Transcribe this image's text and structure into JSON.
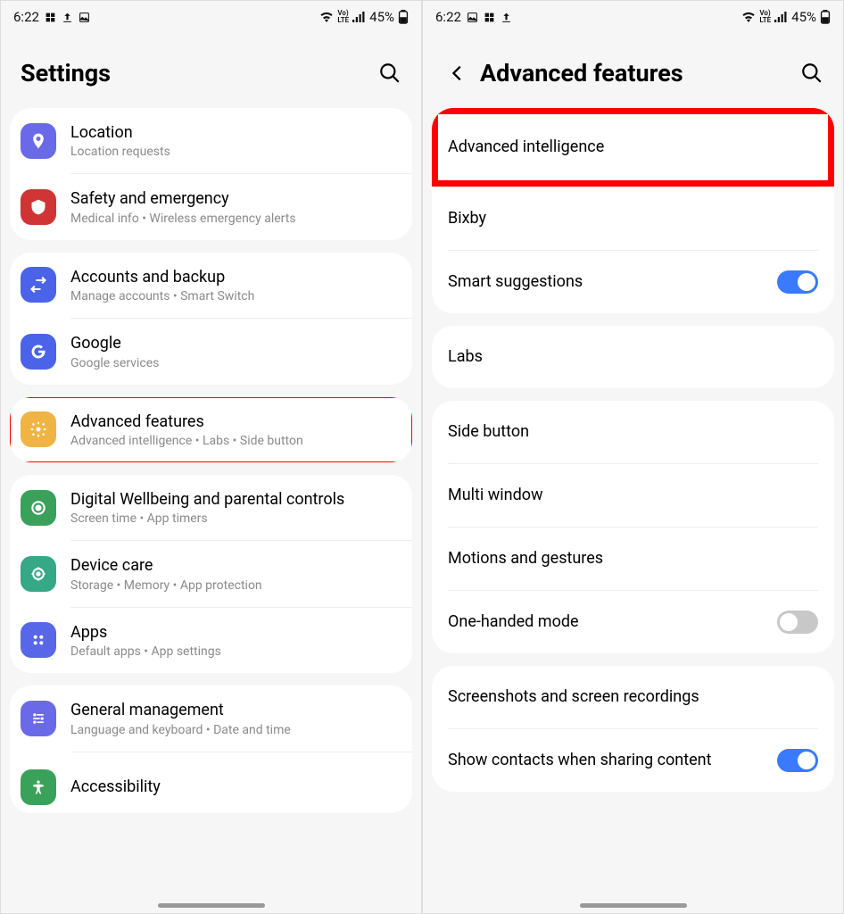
{
  "status": {
    "time": "6:22",
    "battery": "45%"
  },
  "screenLeft": {
    "title": "Settings",
    "rows": {
      "location": {
        "label": "Location",
        "sub": "Location requests"
      },
      "safety": {
        "label": "Safety and emergency",
        "sub": "Medical info  •  Wireless emergency alerts"
      },
      "accounts": {
        "label": "Accounts and backup",
        "sub": "Manage accounts  •  Smart Switch"
      },
      "google": {
        "label": "Google",
        "sub": "Google services"
      },
      "advanced": {
        "label": "Advanced features",
        "sub": "Advanced intelligence  •  Labs  •  Side button"
      },
      "wellbeing": {
        "label": "Digital Wellbeing and parental controls",
        "sub": "Screen time  •  App timers"
      },
      "devicecare": {
        "label": "Device care",
        "sub": "Storage  •  Memory  •  App protection"
      },
      "apps": {
        "label": "Apps",
        "sub": "Default apps  •  App settings"
      },
      "general": {
        "label": "General management",
        "sub": "Language and keyboard  •  Date and time"
      },
      "accessibility": {
        "label": "Accessibility"
      }
    }
  },
  "screenRight": {
    "title": "Advanced features",
    "rows": {
      "ai": "Advanced intelligence",
      "bixby": "Bixby",
      "smart": "Smart suggestions",
      "labs": "Labs",
      "side": "Side button",
      "multi": "Multi window",
      "motions": "Motions and gestures",
      "onehand": "One-handed mode",
      "screenshots": "Screenshots and screen recordings",
      "sharecontacts": "Show contacts when sharing content"
    }
  },
  "icons": {
    "location": {
      "bg": "#6a6ae8"
    },
    "safety": {
      "bg": "#d13434"
    },
    "accounts": {
      "bg": "#4a63e8"
    },
    "google": {
      "bg": "#4a63e8"
    },
    "advanced": {
      "bg": "#f0b445"
    },
    "wellbeing": {
      "bg": "#3aa15a"
    },
    "devicecare": {
      "bg": "#36a886"
    },
    "apps": {
      "bg": "#5866e8"
    },
    "general": {
      "bg": "#6a6ae8"
    },
    "accessibility": {
      "bg": "#3aa15a"
    }
  }
}
